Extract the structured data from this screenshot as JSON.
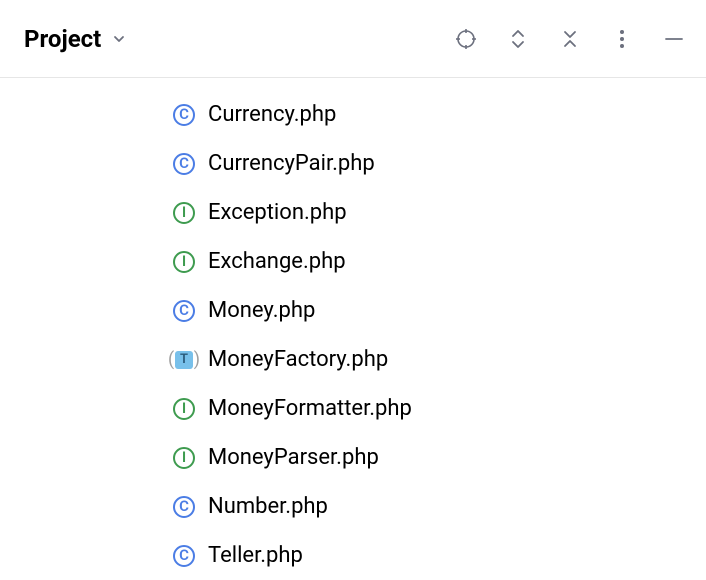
{
  "header": {
    "title": "Project"
  },
  "files": [
    {
      "name": "Currency.php",
      "kind": "class"
    },
    {
      "name": "CurrencyPair.php",
      "kind": "class"
    },
    {
      "name": "Exception.php",
      "kind": "interface"
    },
    {
      "name": "Exchange.php",
      "kind": "interface"
    },
    {
      "name": "Money.php",
      "kind": "class"
    },
    {
      "name": "MoneyFactory.php",
      "kind": "trait"
    },
    {
      "name": "MoneyFormatter.php",
      "kind": "interface"
    },
    {
      "name": "MoneyParser.php",
      "kind": "interface"
    },
    {
      "name": "Number.php",
      "kind": "class"
    },
    {
      "name": "Teller.php",
      "kind": "class"
    }
  ],
  "iconLetters": {
    "class": "C",
    "interface": "I",
    "trait": "T"
  }
}
